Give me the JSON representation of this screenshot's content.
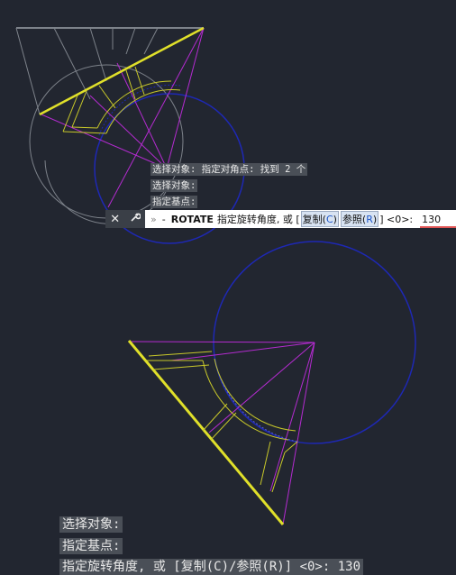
{
  "top": {
    "history": [
      "选择对象: 指定对角点: 找到 2 个",
      "选择对象:",
      "指定基点:"
    ],
    "cmdbar": {
      "close_icon": "✕",
      "wrench_icon": "wrench",
      "recent_icon": "»",
      "dash": "-",
      "command": "ROTATE",
      "prompt": "指定旋转角度, 或 [",
      "opt1": "复制(C)",
      "opt1_key": "C",
      "opt2": "参照(R)",
      "opt2_key": "R",
      "default": "] <0>:",
      "value": "130"
    }
  },
  "bottom": {
    "history": [
      "选择对象:",
      "指定基点:",
      "指定旋转角度, 或 [复制(C)/参照(R)] <0>:  130"
    ]
  },
  "colors": {
    "background": "#222630",
    "yellow": "#e0e02a",
    "magenta": "#b42bd0",
    "blue": "#1e28b4",
    "gray": "#8a8f96"
  }
}
